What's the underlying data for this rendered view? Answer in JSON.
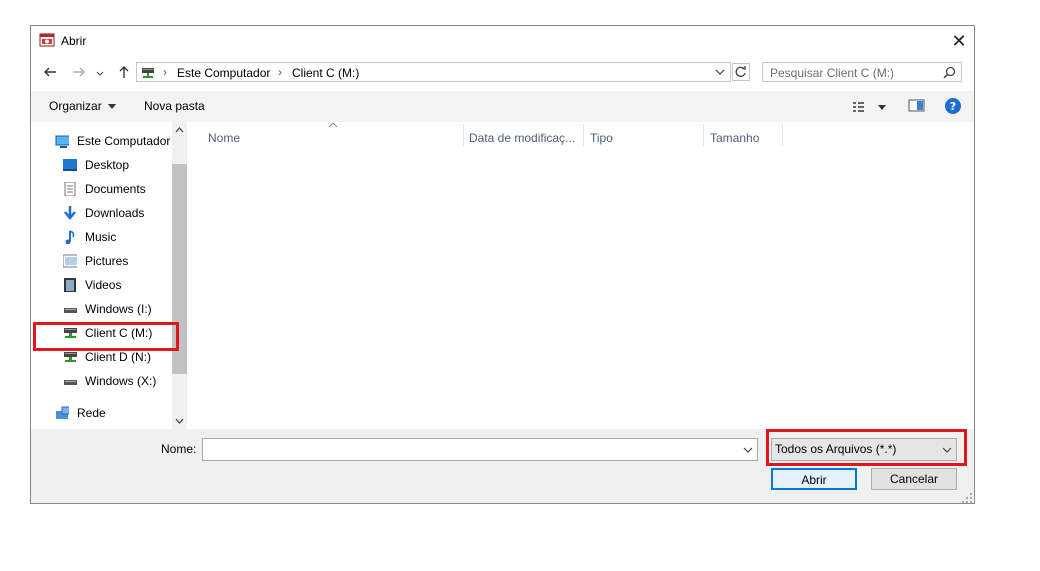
{
  "window": {
    "title": "Abrir",
    "close_glyph": "✕"
  },
  "address": {
    "crumbs": [
      "Este Computador",
      "Client C (M:)"
    ],
    "search_placeholder": "Pesquisar Client C (M:)"
  },
  "toolbar": {
    "organize": "Organizar",
    "new_folder": "Nova pasta"
  },
  "nav": {
    "items": [
      {
        "label": "Este Computador",
        "icon": "computer-icon"
      },
      {
        "label": "Desktop",
        "icon": "desktop-icon"
      },
      {
        "label": "Documents",
        "icon": "documents-icon"
      },
      {
        "label": "Downloads",
        "icon": "downloads-icon"
      },
      {
        "label": "Music",
        "icon": "music-icon"
      },
      {
        "label": "Pictures",
        "icon": "pictures-icon"
      },
      {
        "label": "Videos",
        "icon": "videos-icon"
      },
      {
        "label": "Windows (I:)",
        "icon": "drive-icon"
      },
      {
        "label": "Client C (M:)",
        "icon": "network-drive-icon"
      },
      {
        "label": "Client D (N:)",
        "icon": "network-drive-icon"
      },
      {
        "label": "Windows (X:)",
        "icon": "drive-icon"
      },
      {
        "label": "Rede",
        "icon": "network-icon"
      }
    ]
  },
  "columns": [
    "Nome",
    "Data de modificaç...",
    "Tipo",
    "Tamanho"
  ],
  "footer": {
    "name_label": "Nome:",
    "filename_value": "",
    "filter_value": "Todos os Arquivos (*.*)",
    "open_button": "Abrir",
    "cancel_button": "Cancelar"
  },
  "colors": {
    "highlight": "#e0151e",
    "accent": "#0078d7"
  }
}
